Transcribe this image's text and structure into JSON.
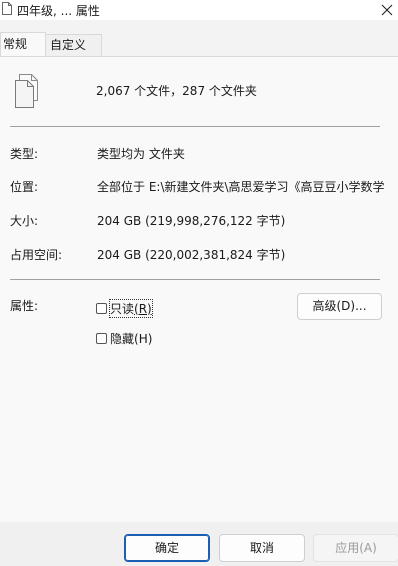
{
  "window": {
    "title": "四年级, ... 属性",
    "icon": "file-icon",
    "close_icon": "close-icon"
  },
  "tabs": [
    {
      "label": "常规",
      "active": true
    },
    {
      "label": "自定义",
      "active": false
    }
  ],
  "general": {
    "icon": "multiple-files-icon",
    "summary": "2,067 个文件，287 个文件夹",
    "rows": [
      {
        "label": "类型:",
        "value": "类型均为 文件夹"
      },
      {
        "label": "位置:",
        "value": "全部位于 E:\\新建文件夹\\高思爱学习《高豆豆小学数学"
      },
      {
        "label": "大小:",
        "value": "204 GB (219,998,276,122 字节)"
      },
      {
        "label": "占用空间:",
        "value": "204 GB (220,002,381,824 字节)"
      }
    ],
    "attributes": {
      "label": "属性:",
      "readonly": {
        "text": "只读",
        "key": "(R)",
        "checked": false
      },
      "hidden": {
        "text": "隐藏",
        "key": "(H)",
        "checked": false
      },
      "advanced_button": {
        "text": "高级",
        "key": "(D)...",
        "full": "高级(D)..."
      }
    }
  },
  "buttons": {
    "ok": "确定",
    "cancel": "取消",
    "apply": "应用",
    "apply_key": "(A)"
  }
}
